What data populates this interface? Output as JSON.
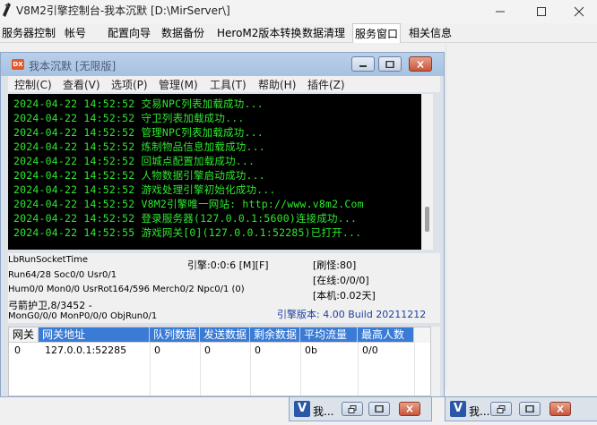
{
  "main_window": {
    "title": "V8M2引擎控制台-我本沉默 [D:\\MirServer\\]"
  },
  "main_tabs": [
    {
      "label": "服务器控制"
    },
    {
      "label": "帐号"
    },
    {
      "label": "配置向导"
    },
    {
      "label": "数据备份"
    },
    {
      "label": "HeroM2版本转换"
    },
    {
      "label": "数据清理"
    },
    {
      "label": "服务窗口"
    },
    {
      "label": "相关信息"
    }
  ],
  "active_tab_index": 6,
  "inner_window": {
    "icon_text": "DX",
    "title": "我本沉默 [无限版]",
    "menu": [
      {
        "label": "控制(C)"
      },
      {
        "label": "查看(V)"
      },
      {
        "label": "选项(P)"
      },
      {
        "label": "管理(M)"
      },
      {
        "label": "工具(T)"
      },
      {
        "label": "帮助(H)"
      },
      {
        "label": "插件(Z)"
      }
    ]
  },
  "console_log": [
    {
      "text": "2024-04-22 14:52:52 交易NPC列表加载成功..."
    },
    {
      "text": "2024-04-22 14:52:52 守卫列表加载成功..."
    },
    {
      "text": "2024-04-22 14:52:52 管理NPC列表加载成功..."
    },
    {
      "text": "2024-04-22 14:52:52 炼制物品信息加载成功..."
    },
    {
      "text": "2024-04-22 14:52:52 回城点配置加载成功..."
    },
    {
      "text": "2024-04-22 14:52:52 人物数据引擎启动成功..."
    },
    {
      "text": "2024-04-22 14:52:52 游戏处理引擎初始化成功..."
    },
    {
      "text": "2024-04-22 14:52:52 V8M2引擎唯一网站: http://www.v8m2.Com"
    },
    {
      "text": "2024-04-22 14:52:52 登录服务器(127.0.0.1:5600)连接成功..."
    },
    {
      "text": "2024-04-22 14:52:55 游戏网关[0](127.0.0.1:52285)已打开..."
    }
  ],
  "stats": {
    "lb_run": "LbRunSocketTime",
    "engine": "引擎:0:0:6 [M][F]",
    "refresh": "[刷怪:80]",
    "run": "Run64/28 Soc0/0 Usr0/1",
    "online": "[在线:0/0/0]",
    "hum": "Hum0/0 Mon0/0 UsrRot164/596 Merch0/2 Npc0/1 (0)",
    "local": "[本机:0.02天]",
    "archer": "弓箭护卫,8/3452 -",
    "mon": "MonG0/0/0 MonP0/0/0 ObjRun0/1",
    "version": "引擎版本: 4.00 Build 20211212"
  },
  "gateway_table": {
    "headers": [
      "网关",
      "网关地址",
      "队列数据",
      "发送数据",
      "剩余数据",
      "平均流量",
      "最高人数"
    ],
    "rows": [
      [
        "0",
        "127.0.0.1:52285",
        "0",
        "0",
        "0",
        "0b",
        "0/0"
      ]
    ]
  },
  "taskbar": [
    {
      "icon_text": "V",
      "label": "我..."
    },
    {
      "icon_text": "V",
      "label": "我..."
    }
  ]
}
